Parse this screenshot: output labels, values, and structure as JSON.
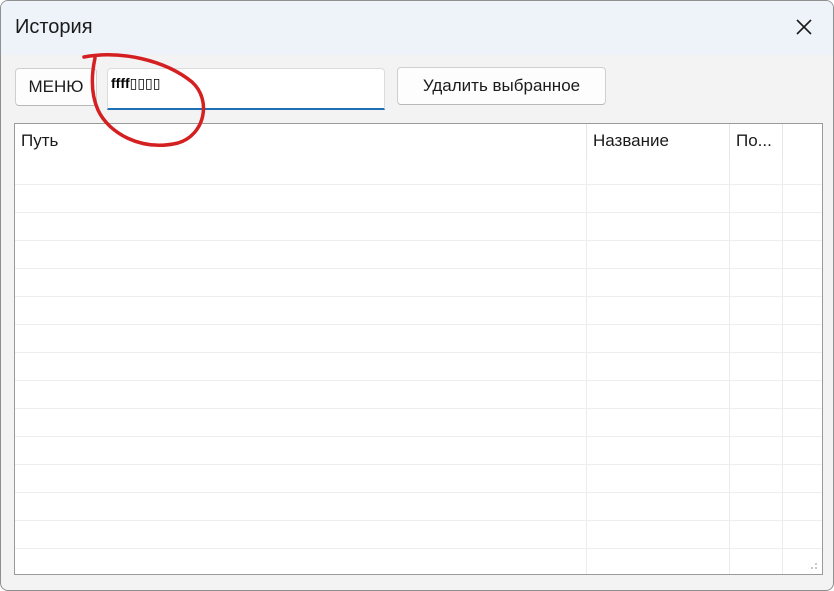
{
  "window": {
    "title": "История"
  },
  "toolbar": {
    "menu_label": "МЕНЮ",
    "search_value": "ffff▯▯▯▯",
    "delete_label": "Удалить выбранное"
  },
  "table": {
    "columns": [
      "Путь",
      "Название",
      "По..."
    ],
    "rows": []
  },
  "colors": {
    "titlebar": "#eef2f9",
    "accent_underline": "#1f6fb5",
    "annotation": "#d42020"
  }
}
